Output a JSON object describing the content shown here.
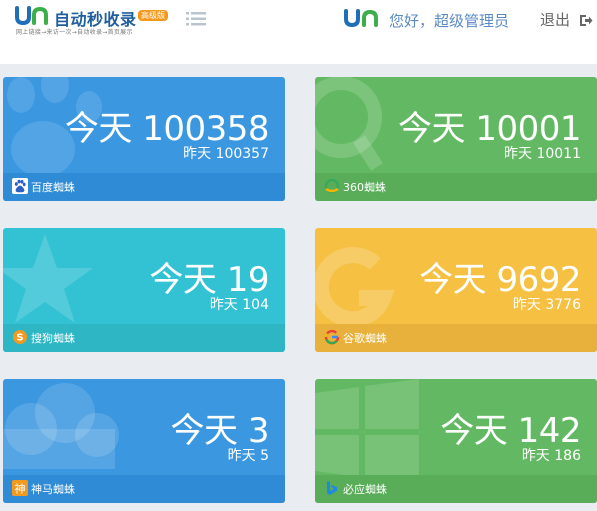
{
  "header": {
    "logo_text": "自动秒收录",
    "logo_badge": "高级版",
    "logo_slogan": "网上链接→来访一次→自动收录→首页展示",
    "greeting": "您好，超级管理员",
    "logout_label": "退出"
  },
  "cards": [
    {
      "id": "baidu",
      "today_prefix": "今天",
      "today_value": "100358",
      "yesterday_prefix": "昨天",
      "yesterday_value": "100357",
      "label": "百度蜘蛛",
      "icon": "paw-icon",
      "color": "#3a97e0"
    },
    {
      "id": "360",
      "today_prefix": "今天",
      "today_value": "10001",
      "yesterday_prefix": "昨天",
      "yesterday_value": "10011",
      "label": "360蜘蛛",
      "icon": "360-search-icon",
      "color": "#63b963"
    },
    {
      "id": "sogou",
      "today_prefix": "今天",
      "today_value": "19",
      "yesterday_prefix": "昨天",
      "yesterday_value": "104",
      "label": "搜狗蜘蛛",
      "icon": "star-icon",
      "color": "#33c2d3"
    },
    {
      "id": "google",
      "today_prefix": "今天",
      "today_value": "9692",
      "yesterday_prefix": "昨天",
      "yesterday_value": "3776",
      "label": "谷歌蜘蛛",
      "icon": "google-g-icon",
      "color": "#f6c042"
    },
    {
      "id": "shenma",
      "today_prefix": "今天",
      "today_value": "3",
      "yesterday_prefix": "昨天",
      "yesterday_value": "5",
      "label": "神马蜘蛛",
      "icon": "cloud-icon",
      "color": "#3a97e0"
    },
    {
      "id": "bing",
      "today_prefix": "今天",
      "today_value": "142",
      "yesterday_prefix": "昨天",
      "yesterday_value": "186",
      "label": "必应蜘蛛",
      "icon": "windows-icon",
      "color": "#63b963"
    }
  ],
  "shenma_icon_char": "神"
}
